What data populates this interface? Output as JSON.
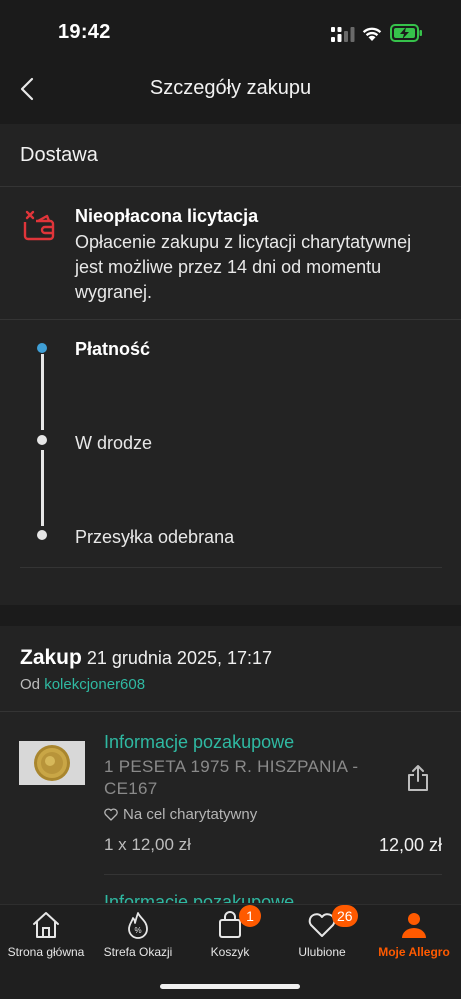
{
  "status_bar": {
    "time": "19:42"
  },
  "nav": {
    "title": "Szczegóły zakupu"
  },
  "delivery": {
    "section_title": "Dostawa",
    "alert_title": "Nieopłacona licytacja",
    "alert_text": "Opłacenie zakupu z licytacji charytatywnej jest możliwe przez 14 dni od momentu wygranej.",
    "steps": [
      "Płatność",
      "W drodze",
      "Przesyłka odebrana"
    ]
  },
  "purchase": {
    "label": "Zakup",
    "date": "21 grudnia 2025, 17:17",
    "seller_prefix": "Od",
    "seller": "kolekcjoner608",
    "item": {
      "info_link": "Informacje pozakupowe",
      "name": "1 PESETA 1975 R. HISZPANIA - CE167",
      "charity": "Na cel charytatywny",
      "quantity_price": "1 x 12,00 zł",
      "total": "12,00 zł"
    },
    "next_link_partial": "Informacje pozakupowe"
  },
  "tabbar": {
    "tabs": [
      {
        "label": "Strona główna",
        "icon": "home-icon"
      },
      {
        "label": "Strefa Okazji",
        "icon": "deals-flame-icon"
      },
      {
        "label": "Koszyk",
        "icon": "cart-bag-icon",
        "badge": "1"
      },
      {
        "label": "Ulubione",
        "icon": "heart-icon",
        "badge": "26"
      },
      {
        "label": "Moje Allegro",
        "icon": "user-icon",
        "active": true
      }
    ]
  },
  "colors": {
    "accent": "#ff5a00",
    "link": "#2fb9a2",
    "alert_red": "#e0353a",
    "step_active": "#3f9fd6"
  }
}
